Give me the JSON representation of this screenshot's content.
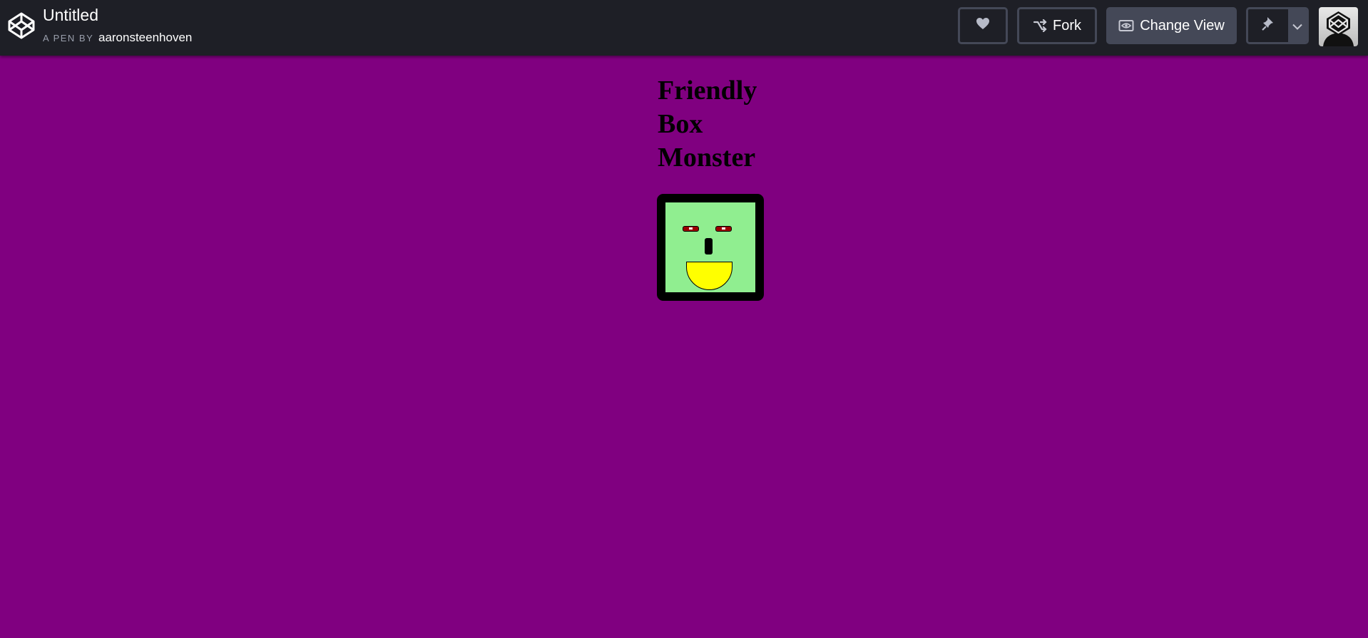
{
  "header": {
    "title": "Untitled",
    "by_prefix": "A PEN BY",
    "author": "aaronsteenhoven",
    "buttons": {
      "heart_icon": "heart-icon",
      "fork_label": "Fork",
      "change_view_label": "Change View",
      "pin_icon": "pin-icon",
      "dropdown_icon": "chevron-down-icon"
    }
  },
  "preview": {
    "title": "Friendly Box Monster",
    "background": "#800080",
    "monster": {
      "face_color": "#90ee90",
      "border_color": "#000000",
      "eye_color": "#9b0000",
      "mouth_color": "#ffff00"
    }
  }
}
